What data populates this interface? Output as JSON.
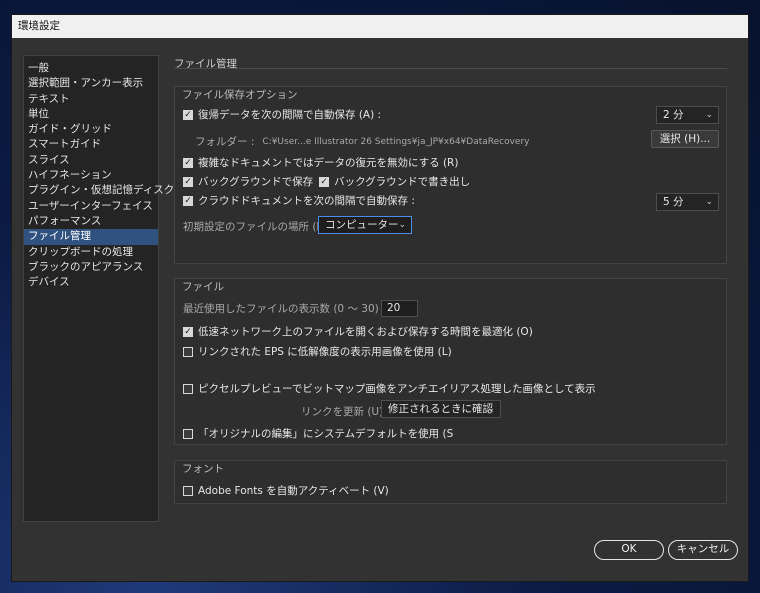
{
  "window": {
    "title": "環境設定"
  },
  "sidebar": {
    "items": [
      {
        "label": "一般"
      },
      {
        "label": "選択範囲・アンカー表示"
      },
      {
        "label": "テキスト"
      },
      {
        "label": "単位"
      },
      {
        "label": "ガイド・グリッド"
      },
      {
        "label": "スマートガイド"
      },
      {
        "label": "スライス"
      },
      {
        "label": "ハイフネーション"
      },
      {
        "label": "プラグイン・仮想記憶ディスク"
      },
      {
        "label": "ユーザーインターフェイス"
      },
      {
        "label": "パフォーマンス"
      },
      {
        "label": "ファイル管理"
      },
      {
        "label": "クリップボードの処理"
      },
      {
        "label": "ブラックのアピアランス"
      },
      {
        "label": "デバイス"
      }
    ],
    "selected": "ファイル管理"
  },
  "main": {
    "title": "ファイル管理",
    "save_options": {
      "title": "ファイル保存オプション",
      "auto_save_label": "復帰データを次の間隔で自動保存 (A) :",
      "auto_save_checked": true,
      "auto_save_interval": "2 分",
      "folder_label": "フォルダー :",
      "folder_path": "C:¥User...e Illustrator 26 Settings¥ja_JP¥x64¥DataRecovery",
      "choose_button": "選択 (H)...",
      "complex_doc_label": "複雑なドキュメントではデータの復元を無効にする (R)",
      "complex_doc_checked": true,
      "bg_save_label": "バックグラウンドで保存",
      "bg_save_checked": true,
      "bg_export_label": "バックグラウンドで書き出し",
      "bg_export_checked": true,
      "cloud_auto_save_label": "クラウドドキュメントを次の間隔で自動保存 :",
      "cloud_auto_save_checked": true,
      "cloud_interval": "5 分",
      "default_location_label": "初期設定のファイルの場所 (D) :",
      "default_location_value": "コンピューター"
    },
    "files": {
      "title": "ファイル",
      "recent_count_label": "最近使用したファイルの表示数 (0 ～ 30) (N) :",
      "recent_count_value": "20",
      "slow_network_label": "低速ネットワーク上のファイルを開くおよび保存する時間を最適化 (O)",
      "slow_network_checked": true,
      "linked_eps_label": "リンクされた EPS に低解像度の表示用画像を使用 (L)",
      "linked_eps_checked": false,
      "pixel_preview_label": "ピクセルプレビューでビットマップ画像をアンチエイリアス処理した画像として表示",
      "pixel_preview_checked": false,
      "update_links_label": "リンクを更新 (U) :",
      "update_links_value": "修正されるときに確認",
      "edit_original_label": "「オリジナルの編集」にシステムデフォルトを使用 (S",
      "edit_original_checked": false
    },
    "fonts": {
      "title": "フォント",
      "adobe_fonts_label": "Adobe Fonts を自動アクティベート (V)",
      "adobe_fonts_checked": false
    }
  },
  "footer": {
    "ok_label": "OK",
    "cancel_label": "キャンセル"
  },
  "checkmark": "✓",
  "colors": {
    "selection": "#2f5280",
    "focus_border": "#4a8eea"
  }
}
